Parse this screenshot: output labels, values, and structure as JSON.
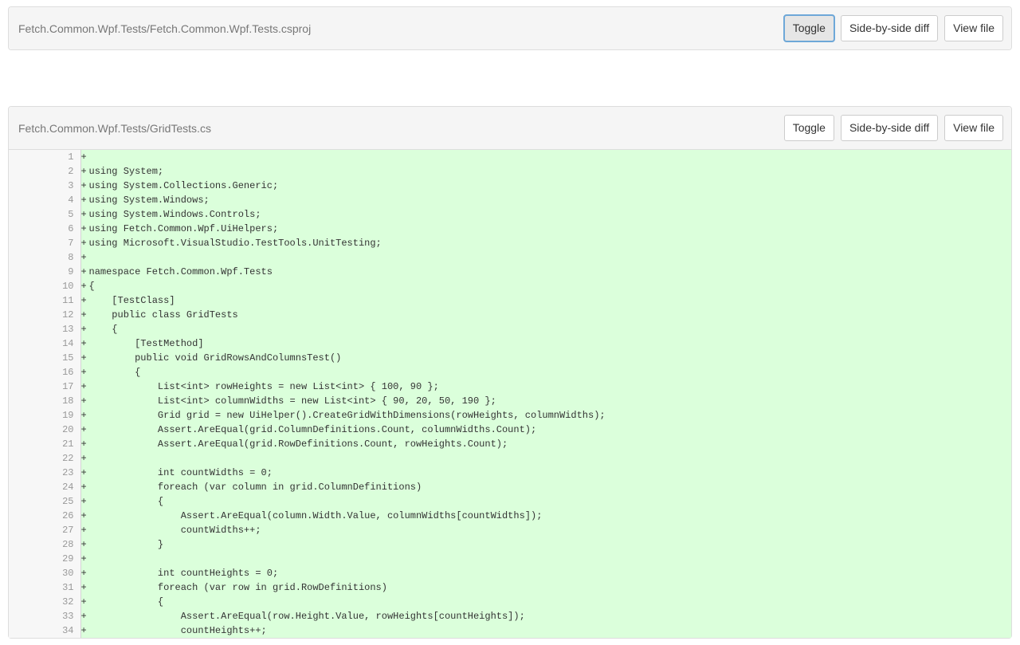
{
  "buttons": {
    "toggle": "Toggle",
    "sideBySide": "Side-by-side diff",
    "viewFile": "View file"
  },
  "files": [
    {
      "path": "Fetch.Common.Wpf.Tests/Fetch.Common.Wpf.Tests.csproj",
      "collapsed": true,
      "toggleActive": true,
      "lines": []
    },
    {
      "path": "Fetch.Common.Wpf.Tests/GridTests.cs",
      "collapsed": false,
      "toggleActive": false,
      "lines": [
        {
          "old": "",
          "new": "1",
          "type": "added",
          "text": ""
        },
        {
          "old": "",
          "new": "2",
          "type": "added",
          "text": "using System;"
        },
        {
          "old": "",
          "new": "3",
          "type": "added",
          "text": "using System.Collections.Generic;"
        },
        {
          "old": "",
          "new": "4",
          "type": "added",
          "text": "using System.Windows;"
        },
        {
          "old": "",
          "new": "5",
          "type": "added",
          "text": "using System.Windows.Controls;"
        },
        {
          "old": "",
          "new": "6",
          "type": "added",
          "text": "using Fetch.Common.Wpf.UiHelpers;"
        },
        {
          "old": "",
          "new": "7",
          "type": "added",
          "text": "using Microsoft.VisualStudio.TestTools.UnitTesting;"
        },
        {
          "old": "",
          "new": "8",
          "type": "added",
          "text": ""
        },
        {
          "old": "",
          "new": "9",
          "type": "added",
          "text": "namespace Fetch.Common.Wpf.Tests"
        },
        {
          "old": "",
          "new": "10",
          "type": "added",
          "text": "{"
        },
        {
          "old": "",
          "new": "11",
          "type": "added",
          "text": "    [TestClass]"
        },
        {
          "old": "",
          "new": "12",
          "type": "added",
          "text": "    public class GridTests"
        },
        {
          "old": "",
          "new": "13",
          "type": "added",
          "text": "    {"
        },
        {
          "old": "",
          "new": "14",
          "type": "added",
          "text": "        [TestMethod]"
        },
        {
          "old": "",
          "new": "15",
          "type": "added",
          "text": "        public void GridRowsAndColumnsTest()"
        },
        {
          "old": "",
          "new": "16",
          "type": "added",
          "text": "        {"
        },
        {
          "old": "",
          "new": "17",
          "type": "added",
          "text": "            List<int> rowHeights = new List<int> { 100, 90 };"
        },
        {
          "old": "",
          "new": "18",
          "type": "added",
          "text": "            List<int> columnWidths = new List<int> { 90, 20, 50, 190 };"
        },
        {
          "old": "",
          "new": "19",
          "type": "added",
          "text": "            Grid grid = new UiHelper().CreateGridWithDimensions(rowHeights, columnWidths);"
        },
        {
          "old": "",
          "new": "20",
          "type": "added",
          "text": "            Assert.AreEqual(grid.ColumnDefinitions.Count, columnWidths.Count);"
        },
        {
          "old": "",
          "new": "21",
          "type": "added",
          "text": "            Assert.AreEqual(grid.RowDefinitions.Count, rowHeights.Count);"
        },
        {
          "old": "",
          "new": "22",
          "type": "added",
          "text": ""
        },
        {
          "old": "",
          "new": "23",
          "type": "added",
          "text": "            int countWidths = 0;"
        },
        {
          "old": "",
          "new": "24",
          "type": "added",
          "text": "            foreach (var column in grid.ColumnDefinitions)"
        },
        {
          "old": "",
          "new": "25",
          "type": "added",
          "text": "            {"
        },
        {
          "old": "",
          "new": "26",
          "type": "added",
          "text": "                Assert.AreEqual(column.Width.Value, columnWidths[countWidths]);"
        },
        {
          "old": "",
          "new": "27",
          "type": "added",
          "text": "                countWidths++;"
        },
        {
          "old": "",
          "new": "28",
          "type": "added",
          "text": "            }"
        },
        {
          "old": "",
          "new": "29",
          "type": "added",
          "text": ""
        },
        {
          "old": "",
          "new": "30",
          "type": "added",
          "text": "            int countHeights = 0;"
        },
        {
          "old": "",
          "new": "31",
          "type": "added",
          "text": "            foreach (var row in grid.RowDefinitions)"
        },
        {
          "old": "",
          "new": "32",
          "type": "added",
          "text": "            {"
        },
        {
          "old": "",
          "new": "33",
          "type": "added",
          "text": "                Assert.AreEqual(row.Height.Value, rowHeights[countHeights]);"
        },
        {
          "old": "",
          "new": "34",
          "type": "added",
          "text": "                countHeights++;"
        }
      ]
    }
  ]
}
